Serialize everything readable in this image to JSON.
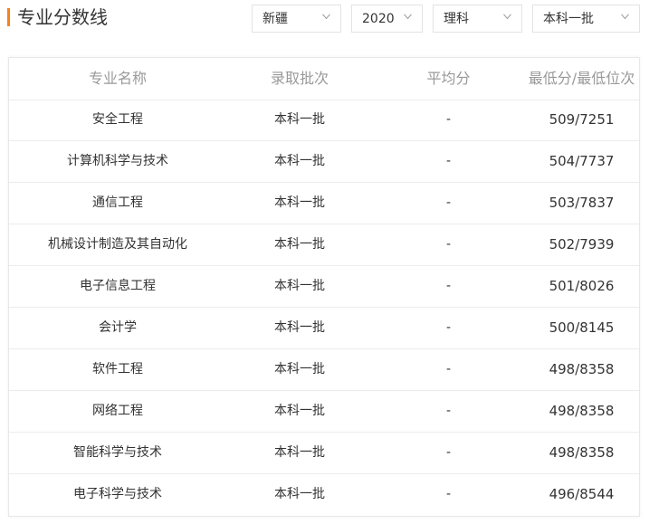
{
  "header": {
    "title": "专业分数线",
    "accent_color": "#f5821f"
  },
  "filters": [
    {
      "value": "新疆",
      "icon": "chevron-down-icon"
    },
    {
      "value": "2020",
      "icon": "chevron-down-icon"
    },
    {
      "value": "理科",
      "icon": "chevron-down-icon"
    },
    {
      "value": "本科一批",
      "icon": "chevron-down-icon"
    }
  ],
  "table": {
    "columns": [
      "专业名称",
      "录取批次",
      "平均分",
      "最低分/最低位次"
    ],
    "rows": [
      {
        "major": "安全工程",
        "batch": "本科一批",
        "avg": "-",
        "min": "509/7251"
      },
      {
        "major": "计算机科学与技术",
        "batch": "本科一批",
        "avg": "-",
        "min": "504/7737"
      },
      {
        "major": "通信工程",
        "batch": "本科一批",
        "avg": "-",
        "min": "503/7837"
      },
      {
        "major": "机械设计制造及其自动化",
        "batch": "本科一批",
        "avg": "-",
        "min": "502/7939"
      },
      {
        "major": "电子信息工程",
        "batch": "本科一批",
        "avg": "-",
        "min": "501/8026"
      },
      {
        "major": "会计学",
        "batch": "本科一批",
        "avg": "-",
        "min": "500/8145"
      },
      {
        "major": "软件工程",
        "batch": "本科一批",
        "avg": "-",
        "min": "498/8358"
      },
      {
        "major": "网络工程",
        "batch": "本科一批",
        "avg": "-",
        "min": "498/8358"
      },
      {
        "major": "智能科学与技术",
        "batch": "本科一批",
        "avg": "-",
        "min": "498/8358"
      },
      {
        "major": "电子科学与技术",
        "batch": "本科一批",
        "avg": "-",
        "min": "496/8544"
      }
    ]
  }
}
